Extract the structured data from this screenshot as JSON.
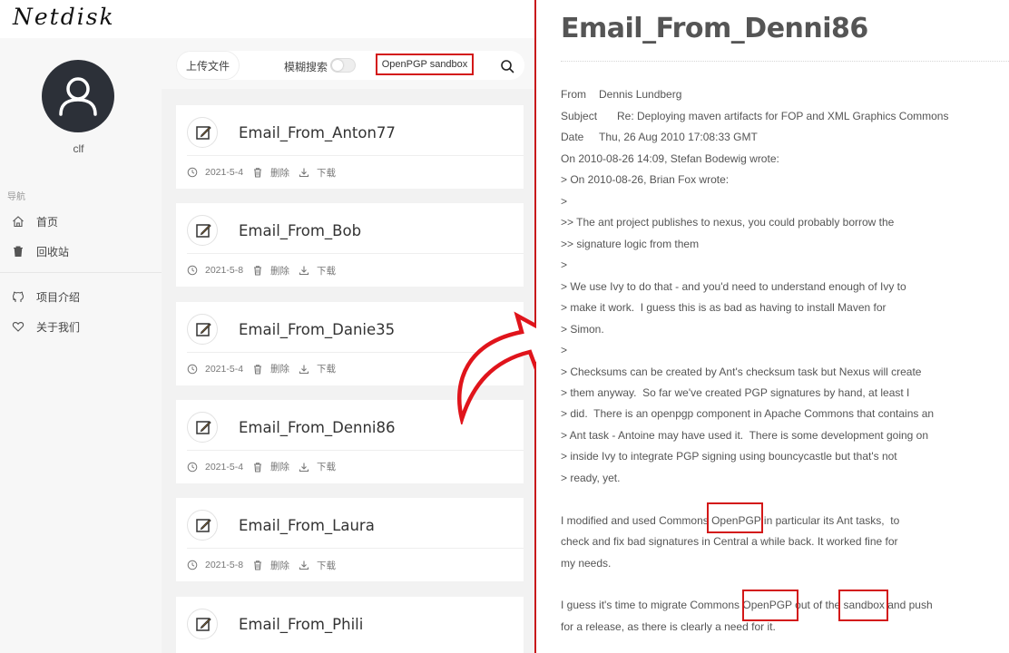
{
  "app": {
    "logo": "Netdisk"
  },
  "sidebar": {
    "username": "clf",
    "nav_heading": "导航",
    "items": [
      {
        "label": "首页",
        "icon": "home-icon"
      },
      {
        "label": "回收站",
        "icon": "trash-icon"
      },
      {
        "label": "项目介绍",
        "icon": "github-icon"
      },
      {
        "label": "关于我们",
        "icon": "heart-icon"
      }
    ]
  },
  "toolbar": {
    "upload_label": "上传文件",
    "fuzzy_label": "模糊搜索",
    "fuzzy_enabled": false,
    "search_value": "OpenPGP sandbox"
  },
  "files": [
    {
      "name": "Email_From_Anton77",
      "date": "2021-5-4",
      "delete": "删除",
      "download": "下载"
    },
    {
      "name": "Email_From_Bob",
      "date": "2021-5-8",
      "delete": "删除",
      "download": "下载"
    },
    {
      "name": "Email_From_Danie35",
      "date": "2021-5-4",
      "delete": "删除",
      "download": "下载"
    },
    {
      "name": "Email_From_Denni86",
      "date": "2021-5-4",
      "delete": "删除",
      "download": "下载"
    },
    {
      "name": "Email_From_Laura",
      "date": "2021-5-8",
      "delete": "删除",
      "download": "下载"
    },
    {
      "name": "Email_From_Phili",
      "date": "",
      "delete": "",
      "download": ""
    }
  ],
  "email": {
    "title": "Email_From_Denni86",
    "from_label": "From",
    "from": "Dennis Lundberg",
    "subject_label": "Subject",
    "subject": "Re: Deploying maven artifacts for FOP and XML Graphics Commons",
    "date_label": "Date",
    "date": "Thu, 26 Aug 2010 17:08:33 GMT",
    "body": [
      "On 2010-08-26 14:09, Stefan Bodewig wrote:",
      "> On 2010-08-26, Brian Fox wrote:",
      ">",
      ">> The ant project publishes to nexus, you could probably borrow the",
      ">> signature logic from them",
      ">",
      "> We use Ivy to do that - and you'd need to understand enough of Ivy to",
      "> make it work.  I guess this is as bad as having to install Maven for",
      "> Simon.",
      ">",
      "> Checksums can be created by Ant's checksum task but Nexus will create",
      "> them anyway.  So far we've created PGP signatures by hand, at least I",
      "> did.  There is an openpgp component in Apache Commons that contains an",
      "> Ant task - Antoine may have used it.  There is some development going on",
      "> inside Ivy to integrate PGP signing using bouncycastle but that's not",
      "> ready, yet.",
      "",
      "I modified and used Commons OpenPGP in particular its Ant tasks,  to",
      "check and fix bad signatures in Central a while back. It worked fine for",
      "my needs.",
      "",
      "I guess it's time to migrate Commons OpenPGP out of the sandbox and push",
      "for a release, as there is clearly a need for it."
    ]
  },
  "colors": {
    "highlight": "#d31818",
    "divider": "#c8171b",
    "avatar_bg": "#2c3038"
  }
}
